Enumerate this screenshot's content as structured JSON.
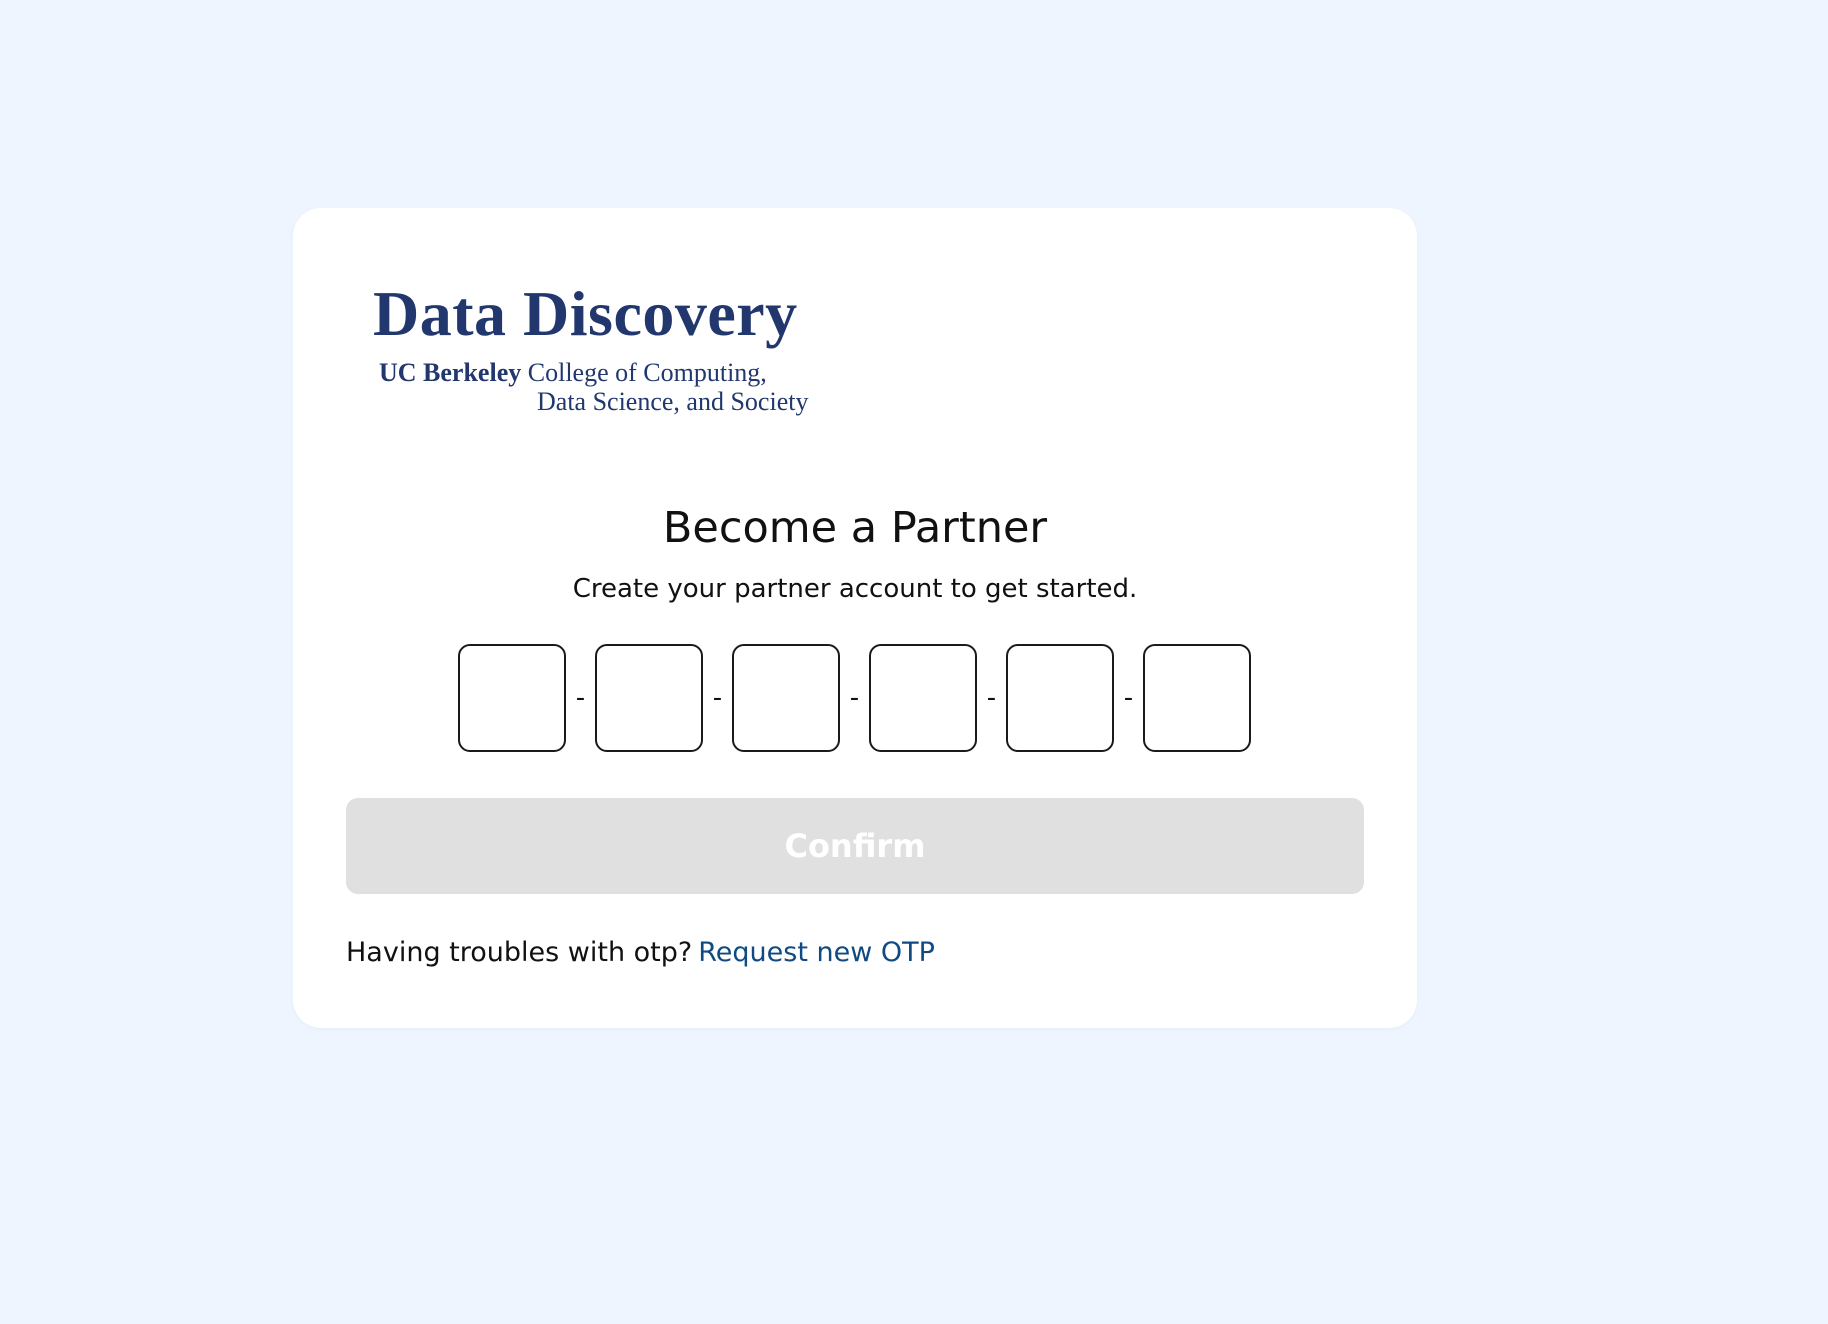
{
  "logo": {
    "title": "Data Discovery",
    "org_bold": "UC Berkeley",
    "org_rest": "College of Computing,",
    "org_line2": "Data Science, and Society"
  },
  "page": {
    "heading": "Become a Partner",
    "subheading": "Create your partner account to get started."
  },
  "otp": {
    "digits": [
      "",
      "",
      "",
      "",
      "",
      ""
    ],
    "separator": "-"
  },
  "confirm": {
    "label": "Confirm",
    "state": "disabled"
  },
  "help": {
    "text": "Having troubles with otp?",
    "link_label": "Request new OTP"
  },
  "colors": {
    "background": "#eef5ff",
    "card": "#ffffff",
    "brand": "#21376e",
    "link": "#0f4a84",
    "button_disabled": "#e0e0e0"
  }
}
